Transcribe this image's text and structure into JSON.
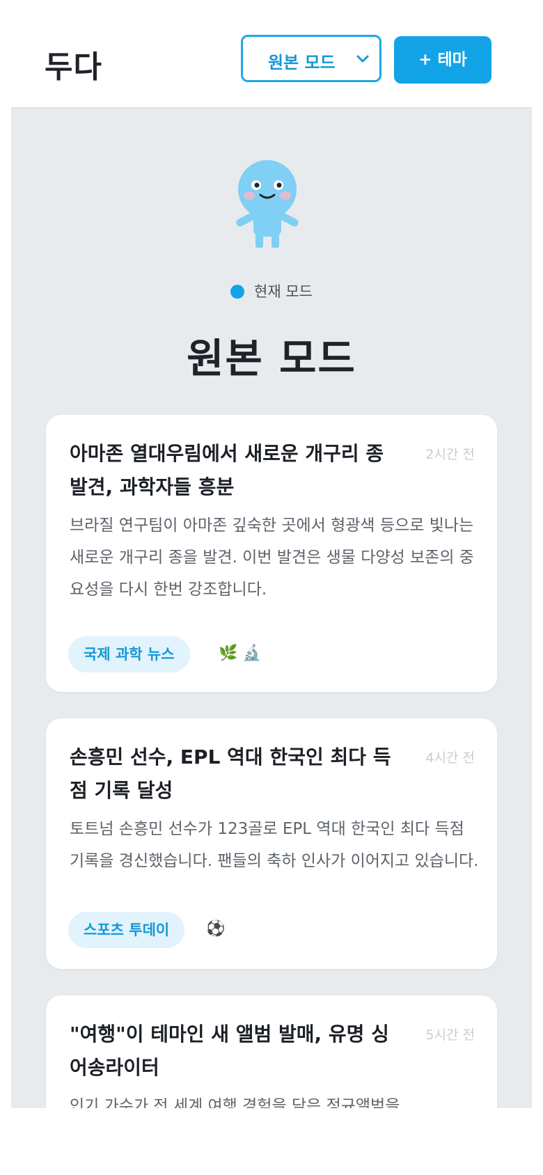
{
  "header": {
    "logo": "두다",
    "mode_select_value": "원본 모드",
    "add_theme_label": "+ 테마"
  },
  "hero": {
    "indicator_label": "현재 모드",
    "mode_title": "원본 모드"
  },
  "colors": {
    "accent": "#12a4e6",
    "background": "#e8ebee",
    "tag_bg": "#e1f3fc"
  },
  "cards": [
    {
      "title": "아마존 열대우림에서 새로운 개구리 종 발견, 과학자들 흥분",
      "time": "2시간 전",
      "summary": "브라질 연구팀이 아마존 깊숙한 곳에서 형광색 등으로 빛나는 새로운 개구리 종을 발견. 이번 발견은 생물 다양성 보존의 중요성을 다시 한번 강조합니다.",
      "tag": "국제 과학 뉴스",
      "emojis": "🌿 🔬"
    },
    {
      "title": "손흥민 선수, EPL 역대 한국인 최다 득점 기록 달성",
      "time": "4시간 전",
      "summary": "토트넘 손흥민 선수가 123골로 EPL 역대 한국인 최다 득점 기록을 경신했습니다. 팬들의 축하 인사가 이어지고 있습니다.",
      "tag": "스포츠 투데이",
      "emojis": "⚽"
    },
    {
      "title": "\"여행\"이 테마인 새 앨범 발매, 유명 싱어송라이터",
      "time": "5시간 전",
      "summary": "인기 가수가 전 세계 여행 경험을 담은 정규앨범을"
    }
  ]
}
